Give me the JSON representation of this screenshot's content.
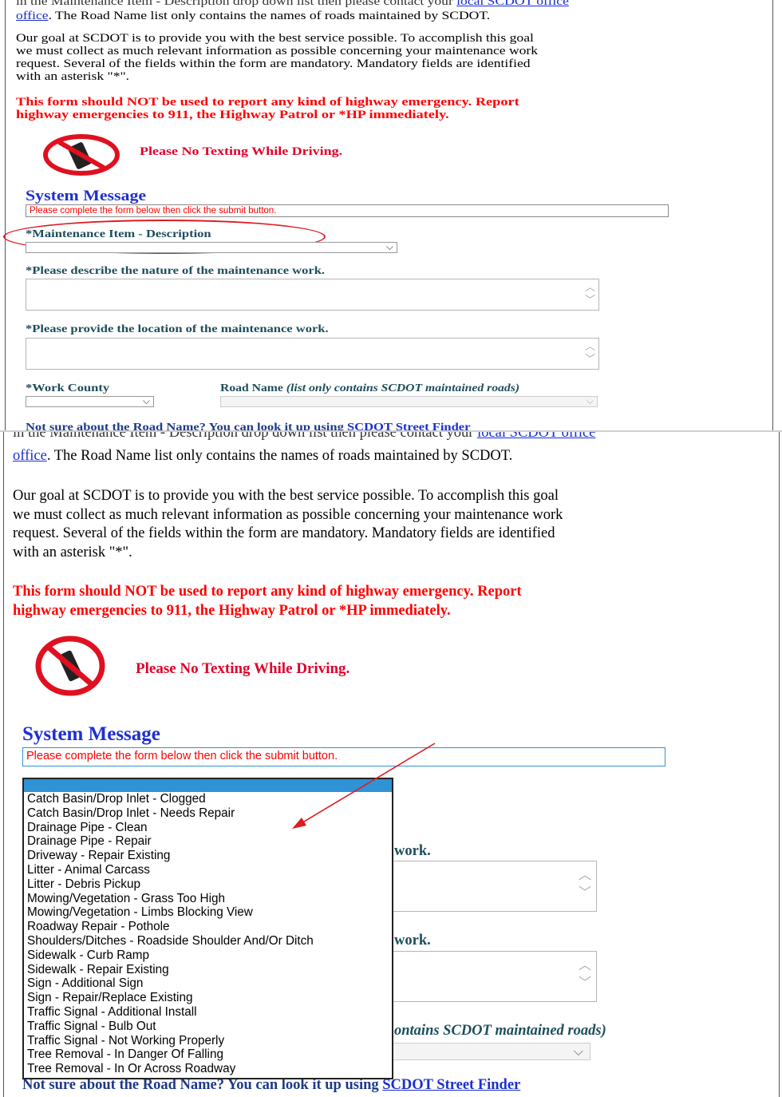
{
  "intro": {
    "top_clip": "in the Maintenance Item - Description drop down list then please contact your",
    "link_text": "local SCDOT office",
    "link_tail": ". The Road Name list only contains the names of roads maintained by SCDOT.",
    "link_line_part": "office",
    "goal_text": "Our goal at SCDOT is to provide you with the best service possible. To accomplish this goal we must collect as much relevant information as possible concerning your maintenance work request. Several of the fields within the form are mandatory. Mandatory fields are identified with an asterisk \"*\".",
    "goal_line1": "Our goal at SCDOT is to provide you with the best service possible. To accomplish this goal",
    "goal_line2": "we must collect as much relevant information as possible concerning your maintenance work",
    "goal_line3": "request. Several of the fields within the form are mandatory. Mandatory fields are identified",
    "goal_line4": "with an asterisk \"*\".",
    "emergency_line1": "This form should NOT be used to report any kind of highway emergency. Report",
    "emergency_line2": "highway emergencies to 911, the Highway Patrol or *HP immediately.",
    "no_texting": "Please No Texting While Driving."
  },
  "system_message": {
    "heading": "System Message",
    "text": "Please complete the form below then click the submit button."
  },
  "form": {
    "maintenance_label": "*Maintenance Item - Description",
    "nature_label": "*Please describe the nature of the maintenance work.",
    "location_label": "*Please provide the location of the maintenance work.",
    "county_label": "*Work County",
    "road_label": "Road Name",
    "road_label_note": "(list only contains SCDOT maintained roads)",
    "street_finder_prefix": "Not sure about the Road Name? You can look it up using",
    "street_finder_link": "SCDOT Street Finder"
  },
  "dropdown": {
    "selected": "",
    "options": [
      "Catch Basin/Drop Inlet - Clogged",
      "Catch Basin/Drop Inlet - Needs Repair",
      "Drainage Pipe - Clean",
      "Drainage Pipe - Repair",
      "Driveway - Repair Existing",
      "Litter - Animal Carcass",
      "Litter - Debris Pickup",
      "Mowing/Vegetation - Grass Too High",
      "Mowing/Vegetation - Limbs Blocking View",
      "Roadway Repair - Pothole",
      "Shoulders/Ditches - Roadside Shoulder And/Or Ditch",
      "Sidewalk - Curb Ramp",
      "Sidewalk - Repair Existing",
      "Sign - Additional Sign",
      "Sign - Repair/Replace Existing",
      "Traffic Signal - Additional Install",
      "Traffic Signal - Bulb Out",
      "Traffic Signal - Not Working Properly",
      "Tree Removal - In Danger Of Falling",
      "Tree Removal - In Or Across Roadway"
    ]
  },
  "partial_labels": {
    "nature_tail": "work.",
    "location_tail": "work.",
    "road_tail": "ontains SCDOT maintained roads)"
  },
  "colors": {
    "link": "#1b2fcf",
    "emergency": "#ff0000",
    "heading": "#1f2fd1",
    "label": "#1d4e5a",
    "annotation": "#e01b24",
    "dropdown_highlight": "#2f93d6"
  },
  "icons": [
    "no-phone-icon",
    "chevron-down-icon",
    "spinner-icon"
  ]
}
